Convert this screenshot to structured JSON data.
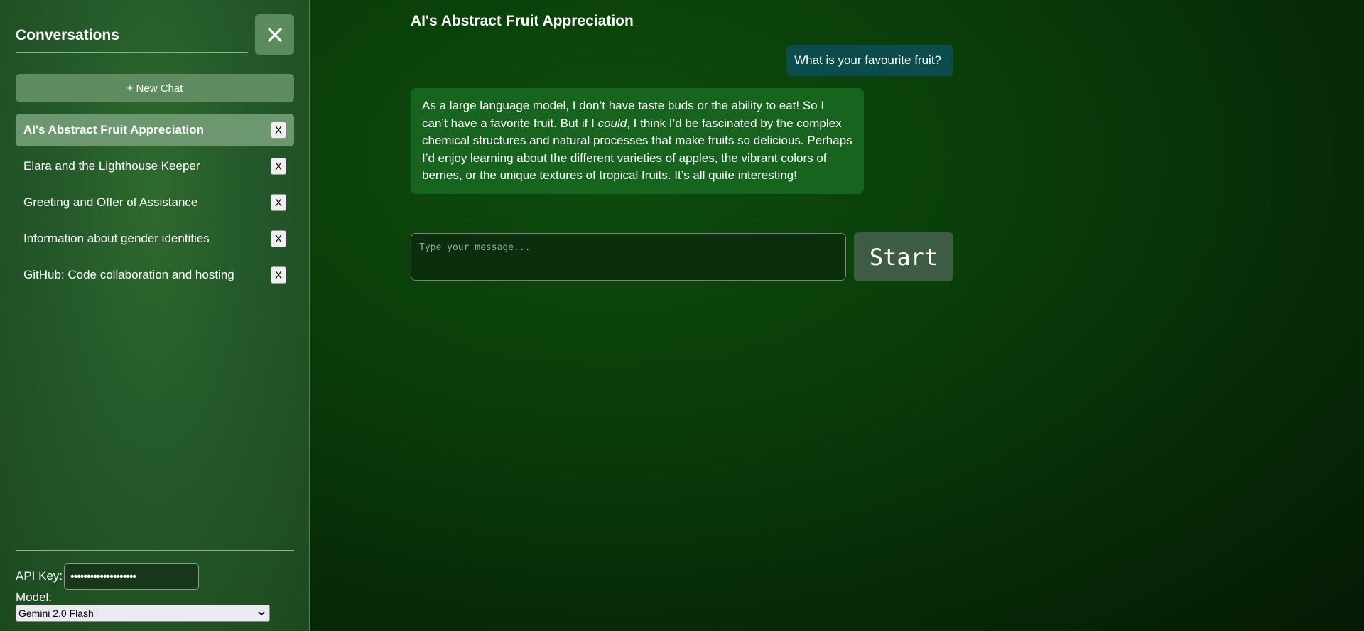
{
  "sidebar": {
    "title": "Conversations",
    "close_icon": "close-icon",
    "new_chat_label": "+ New Chat",
    "conversations": [
      {
        "title": "AI's Abstract Fruit Appreciation",
        "active": true,
        "delete_label": "X"
      },
      {
        "title": "Elara and the Lighthouse Keeper",
        "active": false,
        "delete_label": "X"
      },
      {
        "title": "Greeting and Offer of Assistance",
        "active": false,
        "delete_label": "X"
      },
      {
        "title": "Information about gender identities",
        "active": false,
        "delete_label": "X"
      },
      {
        "title": "GitHub: Code collaboration and hosting",
        "active": false,
        "delete_label": "X"
      }
    ],
    "api_key_label": "API Key:",
    "api_key_value": "••••••••••••••••••••",
    "model_label": "Model:",
    "model_selected": "Gemini 2.0 Flash"
  },
  "chat": {
    "title": "AI's Abstract Fruit Appreciation",
    "messages": [
      {
        "role": "user",
        "text": "What is your favourite fruit?"
      },
      {
        "role": "assistant",
        "text_before": "As a large language model, I don’t have taste buds or the ability to eat! So I can’t have a favorite fruit. But if I ",
        "text_em": "could",
        "text_after": ", I think I’d be fascinated by the complex chemical structures and natural processes that make fruits so delicious. Perhaps I’d enjoy learning about the different varieties of apples, the vibrant colors of berries, or the unique textures of tropical fruits. It’s all quite interesting!"
      }
    ],
    "input_placeholder": "Type your message...",
    "start_label": "Start"
  },
  "colors": {
    "sidebar_active": "#6d976f",
    "user_bubble": "#0c4c4c",
    "assistant_bubble": "#17641f",
    "start_button": "#3e5c44"
  }
}
